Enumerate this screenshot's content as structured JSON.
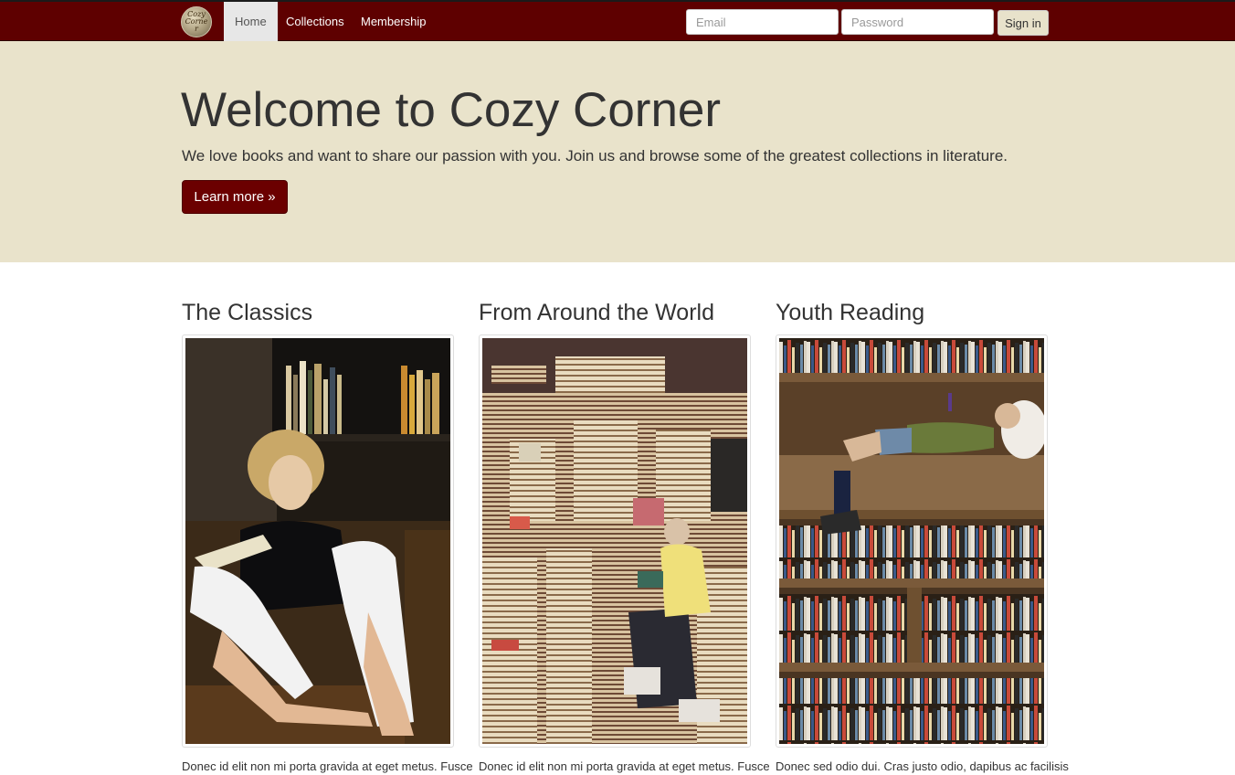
{
  "nav": {
    "logo_text": "Cozy Corner",
    "links": [
      {
        "label": "Home",
        "active": true
      },
      {
        "label": "Collections",
        "active": false
      },
      {
        "label": "Membership",
        "active": false
      }
    ],
    "email_placeholder": "Email",
    "password_placeholder": "Password",
    "signin_label": "Sign in"
  },
  "hero": {
    "title": "Welcome to Cozy Corner",
    "subtitle": "We love books and want to share our passion with you. Join us and browse some of the greatest collections in literature.",
    "button_label": "Learn more »"
  },
  "collections": [
    {
      "title": "The Classics",
      "image": "woman-reading-photo",
      "text": "Donec id elit non mi porta gravida at eget metus. Fusce"
    },
    {
      "title": "From Around the World",
      "image": "man-among-book-stacks-photo",
      "text": "Donec id elit non mi porta gravida at eget metus. Fusce"
    },
    {
      "title": "Youth Reading",
      "image": "child-on-bookshelf-photo",
      "text": "Donec sed odio dui. Cras justo odio, dapibus ac facilisis"
    }
  ],
  "colors": {
    "navbar": "#5e0000",
    "hero_bg": "#e9e3cb",
    "button": "#6b0000"
  }
}
